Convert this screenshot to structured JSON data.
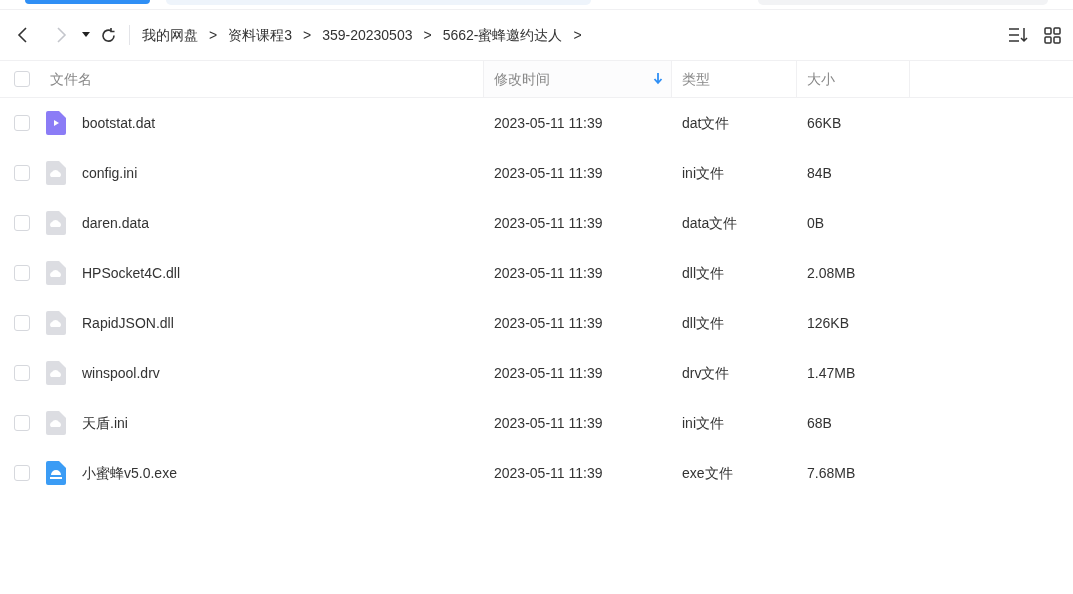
{
  "toolbar": {
    "back_disabled": false,
    "forward_disabled": true,
    "breadcrumb_separator": ">",
    "breadcrumb": [
      "我的网盘",
      "资料课程3",
      "359-20230503",
      "5662-蜜蜂邀约达人"
    ]
  },
  "table": {
    "columns": [
      {
        "label": "文件名",
        "sorted": false
      },
      {
        "label": "修改时间",
        "sorted": true
      },
      {
        "label": "类型",
        "sorted": false
      },
      {
        "label": "大小",
        "sorted": false
      }
    ],
    "all_checked": false,
    "rows": [
      {
        "name": "bootstat.dat",
        "kind": "video",
        "modified": "2023-05-11 11:39",
        "type": "dat文件",
        "size": "66KB",
        "checked": false
      },
      {
        "name": "config.ini",
        "kind": "generic",
        "modified": "2023-05-11 11:39",
        "type": "ini文件",
        "size": "84B",
        "checked": false
      },
      {
        "name": "daren.data",
        "kind": "generic",
        "modified": "2023-05-11 11:39",
        "type": "data文件",
        "size": "0B",
        "checked": false
      },
      {
        "name": "HPSocket4C.dll",
        "kind": "generic",
        "modified": "2023-05-11 11:39",
        "type": "dll文件",
        "size": "2.08MB",
        "checked": false
      },
      {
        "name": "RapidJSON.dll",
        "kind": "generic",
        "modified": "2023-05-11 11:39",
        "type": "dll文件",
        "size": "126KB",
        "checked": false
      },
      {
        "name": "winspool.drv",
        "kind": "generic",
        "modified": "2023-05-11 11:39",
        "type": "drv文件",
        "size": "1.47MB",
        "checked": false
      },
      {
        "name": "天盾.ini",
        "kind": "generic",
        "modified": "2023-05-11 11:39",
        "type": "ini文件",
        "size": "68B",
        "checked": false
      },
      {
        "name": "小蜜蜂v5.0.exe",
        "kind": "app",
        "modified": "2023-05-11 11:39",
        "type": "exe文件",
        "size": "7.68MB",
        "checked": false
      }
    ]
  }
}
